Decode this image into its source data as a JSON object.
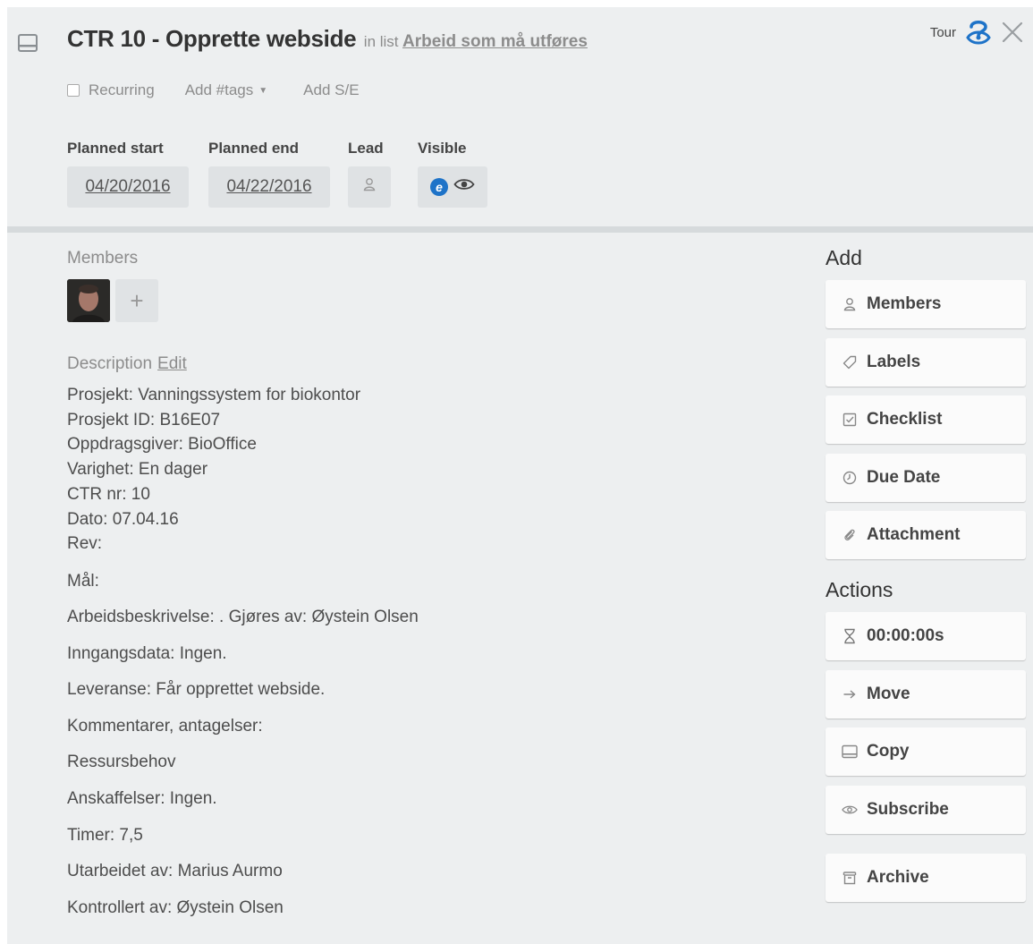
{
  "card": {
    "title": "CTR 10 - Opprette webside",
    "in_list_prefix": "in list",
    "list_name": "Arbeid som må utføres",
    "card_icon": "card-icon",
    "close_icon": "close-icon"
  },
  "tour": {
    "label": "Tour",
    "icon": "tour-icon"
  },
  "meta": {
    "recurring_label": "Recurring",
    "recurring_checked": false,
    "tags_label": "Add #tags",
    "tags_caret": "▼",
    "se_label": "Add S/E"
  },
  "fields": {
    "planned_start_label": "Planned start",
    "planned_start_value": "04/20/2016",
    "planned_end_label": "Planned end",
    "planned_end_value": "04/22/2016",
    "lead_label": "Lead",
    "lead_icon": "person-icon",
    "visible_label": "Visible",
    "visible_badge": "e",
    "visible_icon": "eye-icon"
  },
  "members": {
    "label": "Members",
    "add_symbol": "+"
  },
  "description": {
    "label": "Description",
    "edit_label": "Edit",
    "lines": [
      "Prosjekt: Vanningssystem for biokontor",
      "Prosjekt ID: B16E07",
      "Oppdragsgiver: BioOffice",
      "Varighet: En dager",
      "CTR nr: 10",
      "Dato: 07.04.16",
      "Rev:"
    ],
    "paragraphs": [
      "Mål:",
      "Arbeidsbeskrivelse: . Gjøres av: Øystein Olsen",
      "Inngangsdata: Ingen.",
      "Leveranse: Får opprettet webside.",
      "Kommentarer, antagelser:",
      "Ressursbehov",
      "Anskaffelser: Ingen.",
      "Timer: 7,5",
      "Utarbeidet av: Marius Aurmo",
      "Kontrollert av: Øystein Olsen"
    ]
  },
  "sidebar": {
    "add_heading": "Add",
    "add_buttons": [
      {
        "label": "Members",
        "icon": "person-icon"
      },
      {
        "label": "Labels",
        "icon": "tag-icon"
      },
      {
        "label": "Checklist",
        "icon": "checklist-icon"
      },
      {
        "label": "Due Date",
        "icon": "clock-icon"
      },
      {
        "label": "Attachment",
        "icon": "paperclip-icon"
      }
    ],
    "actions_heading": "Actions",
    "action_buttons": [
      {
        "label": "00:00:00s",
        "icon": "timer-icon"
      },
      {
        "label": "Move",
        "icon": "arrow-right-icon"
      },
      {
        "label": "Copy",
        "icon": "copy-icon"
      },
      {
        "label": "Subscribe",
        "icon": "eye-icon"
      },
      {
        "label": "Archive",
        "icon": "archive-icon"
      }
    ]
  },
  "colors": {
    "card_bg": "#edeff0",
    "divider": "#d6dadc",
    "field_bg": "#dfe2e4",
    "visible_badge": "#1e73c8",
    "tour_icon": "#1e73c8"
  }
}
